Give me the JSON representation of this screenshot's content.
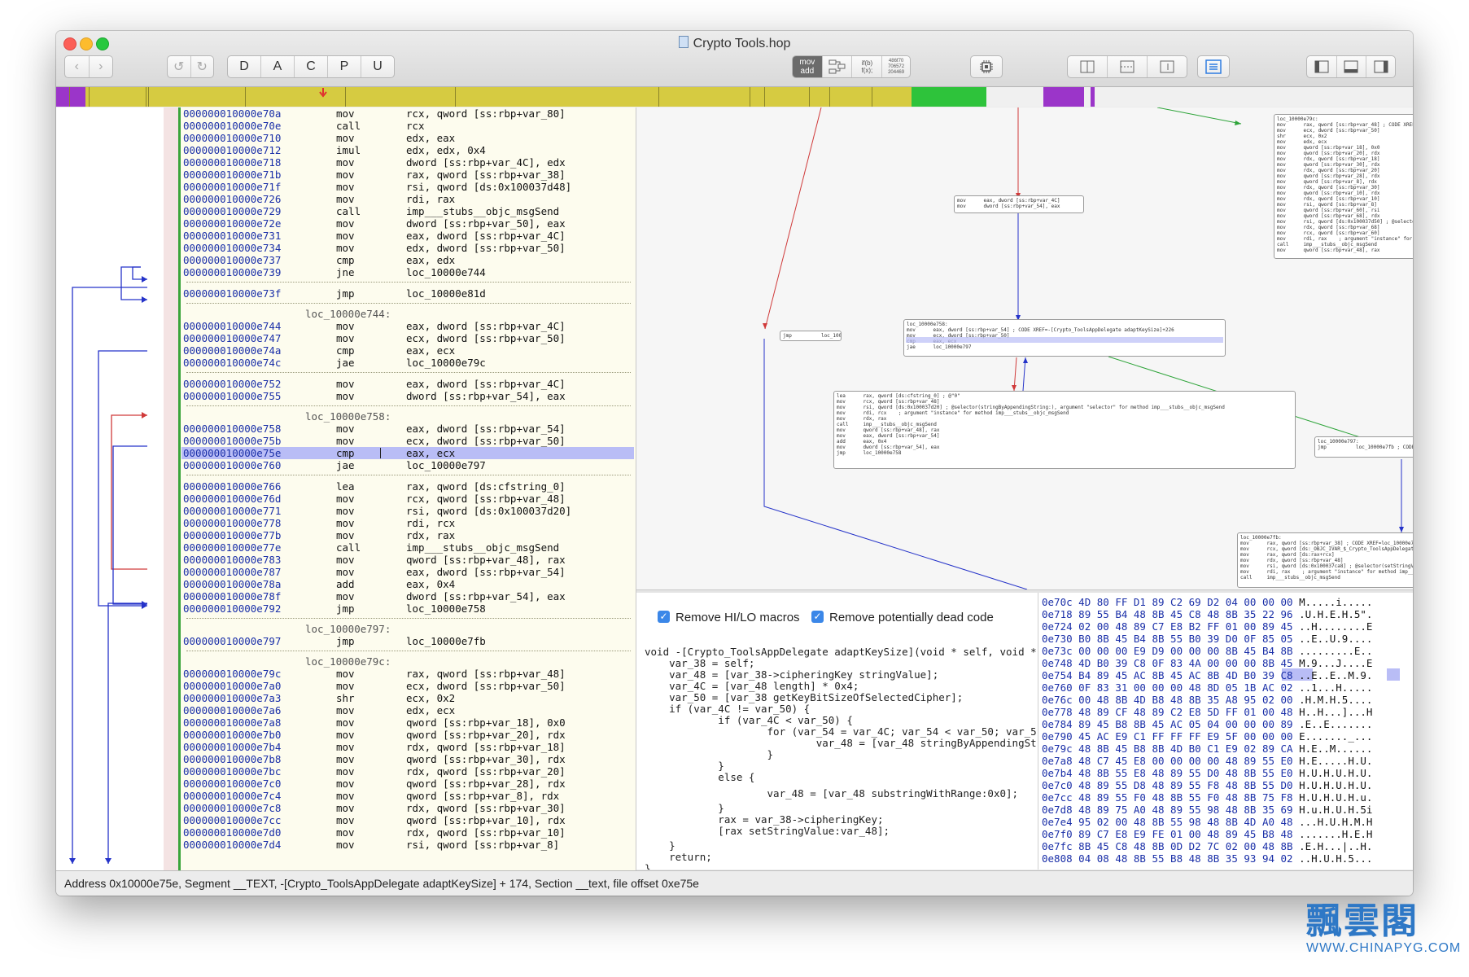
{
  "window": {
    "title": "Crypto Tools.hop",
    "toolbar": {
      "nav_back": "‹",
      "nav_forward": "›",
      "undo": "↺",
      "redo": "↻",
      "type_buttons": [
        "D",
        "A",
        "C",
        "P",
        "U"
      ],
      "mode_asm_line1": "mov",
      "mode_asm_line2": "add",
      "mode_pseudo_line1": "if(b)",
      "mode_pseudo_line2": "f(x);",
      "mode_hex_line1": "486f70",
      "mode_hex_line2": "706572",
      "mode_hex_line3": "204469"
    }
  },
  "asm": {
    "rows": [
      {
        "addr": "000000010000e70a",
        "mn": "mov",
        "op": "rcx, qword [ss:rbp+var_80]"
      },
      {
        "addr": "000000010000e70e",
        "mn": "call",
        "op": "rcx"
      },
      {
        "addr": "000000010000e710",
        "mn": "mov",
        "op": "edx, eax"
      },
      {
        "addr": "000000010000e712",
        "mn": "imul",
        "op": "edx, edx, 0x4"
      },
      {
        "addr": "000000010000e718",
        "mn": "mov",
        "op": "dword [ss:rbp+var_4C], edx"
      },
      {
        "addr": "000000010000e71b",
        "mn": "mov",
        "op": "rax, qword [ss:rbp+var_38]"
      },
      {
        "addr": "000000010000e71f",
        "mn": "mov",
        "op": "rsi, qword [ds:0x100037d48]"
      },
      {
        "addr": "000000010000e726",
        "mn": "mov",
        "op": "rdi, rax"
      },
      {
        "addr": "000000010000e729",
        "mn": "call",
        "op": "imp___stubs__objc_msgSend"
      },
      {
        "addr": "000000010000e72e",
        "mn": "mov",
        "op": "dword [ss:rbp+var_50], eax"
      },
      {
        "addr": "000000010000e731",
        "mn": "mov",
        "op": "eax, dword [ss:rbp+var_4C]"
      },
      {
        "addr": "000000010000e734",
        "mn": "mov",
        "op": "edx, dword [ss:rbp+var_50]"
      },
      {
        "addr": "000000010000e737",
        "mn": "cmp",
        "op": "eax, edx"
      },
      {
        "addr": "000000010000e739",
        "mn": "jne",
        "op": "loc_10000e744"
      },
      {
        "addr": "000000010000e73f",
        "mn": "jmp",
        "op": "loc_10000e81d"
      },
      {
        "addr": "000000010000e744",
        "mn": "mov",
        "op": "eax, dword [ss:rbp+var_4C]"
      },
      {
        "addr": "000000010000e747",
        "mn": "mov",
        "op": "ecx, dword [ss:rbp+var_50]"
      },
      {
        "addr": "000000010000e74a",
        "mn": "cmp",
        "op": "eax, ecx"
      },
      {
        "addr": "000000010000e74c",
        "mn": "jae",
        "op": "loc_10000e79c"
      },
      {
        "addr": "000000010000e752",
        "mn": "mov",
        "op": "eax, dword [ss:rbp+var_4C]"
      },
      {
        "addr": "000000010000e755",
        "mn": "mov",
        "op": "dword [ss:rbp+var_54], eax"
      },
      {
        "addr": "000000010000e758",
        "mn": "mov",
        "op": "eax, dword [ss:rbp+var_54]"
      },
      {
        "addr": "000000010000e75b",
        "mn": "mov",
        "op": "ecx, dword [ss:rbp+var_50]"
      },
      {
        "addr": "000000010000e75e",
        "mn": "cmp",
        "op": "eax, ecx"
      },
      {
        "addr": "000000010000e760",
        "mn": "jae",
        "op": "loc_10000e797"
      },
      {
        "addr": "000000010000e766",
        "mn": "lea",
        "op": "rax, qword [ds:cfstring_0]"
      },
      {
        "addr": "000000010000e76d",
        "mn": "mov",
        "op": "rcx, qword [ss:rbp+var_48]"
      },
      {
        "addr": "000000010000e771",
        "mn": "mov",
        "op": "rsi, qword [ds:0x100037d20]"
      },
      {
        "addr": "000000010000e778",
        "mn": "mov",
        "op": "rdi, rcx"
      },
      {
        "addr": "000000010000e77b",
        "mn": "mov",
        "op": "rdx, rax"
      },
      {
        "addr": "000000010000e77e",
        "mn": "call",
        "op": "imp___stubs__objc_msgSend"
      },
      {
        "addr": "000000010000e783",
        "mn": "mov",
        "op": "qword [ss:rbp+var_48], rax"
      },
      {
        "addr": "000000010000e787",
        "mn": "mov",
        "op": "eax, dword [ss:rbp+var_54]"
      },
      {
        "addr": "000000010000e78a",
        "mn": "add",
        "op": "eax, 0x4"
      },
      {
        "addr": "000000010000e78f",
        "mn": "mov",
        "op": "dword [ss:rbp+var_54], eax"
      },
      {
        "addr": "000000010000e792",
        "mn": "jmp",
        "op": "loc_10000e758"
      },
      {
        "addr": "000000010000e797",
        "mn": "jmp",
        "op": "loc_10000e7fb"
      },
      {
        "addr": "000000010000e79c",
        "mn": "mov",
        "op": "rax, qword [ss:rbp+var_48]"
      },
      {
        "addr": "000000010000e7a0",
        "mn": "mov",
        "op": "ecx, dword [ss:rbp+var_50]"
      },
      {
        "addr": "000000010000e7a3",
        "mn": "shr",
        "op": "ecx, 0x2"
      },
      {
        "addr": "000000010000e7a6",
        "mn": "mov",
        "op": "edx, ecx"
      },
      {
        "addr": "000000010000e7a8",
        "mn": "mov",
        "op": "qword [ss:rbp+var_18], 0x0"
      },
      {
        "addr": "000000010000e7b0",
        "mn": "mov",
        "op": "qword [ss:rbp+var_20], rdx"
      },
      {
        "addr": "000000010000e7b4",
        "mn": "mov",
        "op": "rdx, qword [ss:rbp+var_18]"
      },
      {
        "addr": "000000010000e7b8",
        "mn": "mov",
        "op": "qword [ss:rbp+var_30], rdx"
      },
      {
        "addr": "000000010000e7bc",
        "mn": "mov",
        "op": "rdx, qword [ss:rbp+var_20]"
      },
      {
        "addr": "000000010000e7c0",
        "mn": "mov",
        "op": "qword [ss:rbp+var_28], rdx"
      },
      {
        "addr": "000000010000e7c4",
        "mn": "mov",
        "op": "qword [ss:rbp+var_8], rdx"
      },
      {
        "addr": "000000010000e7c8",
        "mn": "mov",
        "op": "rdx, qword [ss:rbp+var_30]"
      },
      {
        "addr": "000000010000e7cc",
        "mn": "mov",
        "op": "qword [ss:rbp+var_10], rdx"
      },
      {
        "addr": "000000010000e7d0",
        "mn": "mov",
        "op": "rdx, qword [ss:rbp+var_10]"
      },
      {
        "addr": "000000010000e7d4",
        "mn": "mov",
        "op": "rsi, qword [ss:rbp+var_8]"
      }
    ],
    "labels": [
      "loc_10000e744:",
      "loc_10000e758:",
      "loc_10000e797:",
      "loc_10000e79c:"
    ]
  },
  "graph": {
    "block_top_right": "loc_10000e79c:\nmov      rax, qword [ss:rbp+var_48] ; CODE XREF=[Crypt\nmov      ecx, dword [ss:rbp+var_50]\nshr      ecx, 0x2\nmov      edx, ecx\nmov      qword [ss:rbp+var_18], 0x0\nmov      qword [ss:rbp+var_20], rdx\nmov      rdx, qword [ss:rbp+var_18]\nmov      qword [ss:rbp+var_30], rdx\nmov      rdx, qword [ss:rbp+var_20]\nmov      qword [ss:rbp+var_28], rdx\nmov      qword [ss:rbp+var_8], rdx\nmov      rdx, qword [ss:rbp+var_30]\nmov      qword [ss:rbp+var_10], rdx\nmov      rdx, qword [ss:rbp+var_10]\nmov      rsi, qword [ss:rbp+var_8]\nmov      qword [ss:rbp+var_60], rsi\nmov      qword [ss:rbp+var_68], rdx\nmov      rsi, qword [ds:0x100037d50] ; @selector(substr\nmov      rdx, qword [ss:rbp+var_68]\nmov      rcx, qword [ss:rbp+var_60]\nmov      rdi, rax    ; argument \"instance\" for method imp__\ncall     imp___stubs__objc_msgSend\nmov      qword [ss:rbp+var_48], rax",
    "block_small": "mov      eax, dword [ss:rbp+var_4C]\nmov      dword [ss:rbp+var_54], eax",
    "block_jmp": "jmp          loc_10000e81d",
    "block_e758": "loc_10000e758:\nmov      eax, dword [ss:rbp+var_54] ; CODE XREF=-[Crypto_ToolsAppDelegate adaptKeySize]+226\nmov      ecx, dword [ss:rbp+var_50]\ncmp      eax, ecx\njae      loc_10000e797",
    "block_loop": "lea      rax, qword [ds:cfstring_0] ; @\"0\"\nmov      rcx, qword [ss:rbp+var_48]\nmov      rsi, qword [ds:0x100037d20] ; @selector(stringByAppendingString:), argument \"selector\" for method imp___stubs__objc_msgSend\nmov      rdi, rcx    ; argument \"instance\" for method imp___stubs__objc_msgSend\nmov      rdx, rax\ncall     imp___stubs__objc_msgSend\nmov      qword [ss:rbp+var_48], rax\nmov      eax, dword [ss:rbp+var_54]\nadd      eax, 0x4\nmov      dword [ss:rbp+var_54], eax\njmp      loc_10000e758",
    "block_e797": "loc_10000e797:\njmp          loc_10000e7fb ; CODE XREF=-[Crypto",
    "block_e7fb": "loc_10000e7fb:\nmov      rax, qword [ss:rbp+var_38] ; CODE XREF=loc_10000e797\nmov      rcx, qword [ds:_OBJC_IVAR_$_Crypto_ToolsAppDelegate.ciphe\nmov      rax, qword [ds:rax+rcx]\nmov      rdx, qword [ss:rbp+var_48]\nmov      rsi, qword [ds:0x100037ca8] ; @selector(setStringValue:)\nmov      rdi, rax    ; argument \"instance\" for method imp___stub\ncall     imp___stubs__objc_msgSend"
  },
  "pseudo": {
    "option1": "Remove HI/LO macros",
    "option2": "Remove potentially dead code",
    "lines": [
      "void -[Crypto_ToolsAppDelegate adaptKeySize](void * self, void *",
      "    var_38 = self;",
      "    var_48 = [var_38->cipheringKey stringValue];",
      "    var_4C = [var_48 length] * 0x4;",
      "    var_50 = [var_38 getKeyBitSizeOfSelectedCipher];",
      "    if (var_4C != var_50) {",
      "            if (var_4C < var_50) {",
      "                    for (var_54 = var_4C; var_54 < var_50; var_5",
      "                            var_48 = [var_48 stringByAppendingSt",
      "                    }",
      "            }",
      "            else {",
      "                    var_48 = [var_48 substringWithRange:0x0];",
      "            }",
      "            rax = var_38->cipheringKey;",
      "            [rax setStringValue:var_48];",
      "    }",
      "    return;",
      "}"
    ]
  },
  "hex": {
    "rows": [
      {
        "a": "0e70c",
        "b": "4D 80 FF D1 89 C2 69 D2 04 00 00 00",
        "c": "M.....i....."
      },
      {
        "a": "0e718",
        "b": "89 55 B4 48 8B 45 C8 48 8B 35 22 96",
        "c": ".U.H.E.H.5\"."
      },
      {
        "a": "0e724",
        "b": "02 00 48 89 C7 E8 B2 FF 01 00 89 45",
        "c": "..H........E"
      },
      {
        "a": "0e730",
        "b": "B0 8B 45 B4 8B 55 B0 39 D0 0F 85 05",
        "c": "..E..U.9...."
      },
      {
        "a": "0e73c",
        "b": "00 00 00 E9 D9 00 00 00 8B 45 B4 8B",
        "c": ".........E.."
      },
      {
        "a": "0e748",
        "b": "4D B0 39 C8 0F 83 4A 00 00 00 8B 45",
        "c": "M.9...J....E"
      },
      {
        "a": "0e754",
        "b": "B4 89 45 AC 8B 45 AC 8B 4D B0 39 C8",
        "c": "..E..E..M.9."
      },
      {
        "a": "0e760",
        "b": "0F 83 31 00 00 00 48 8D 05 1B AC 02",
        "c": "..1...H....."
      },
      {
        "a": "0e76c",
        "b": "00 48 8B 4D B8 48 8B 35 A8 95 02 00",
        "c": ".H.M.H.5...."
      },
      {
        "a": "0e778",
        "b": "48 89 CF 48 89 C2 E8 5D FF 01 00 48",
        "c": "H..H...]...H"
      },
      {
        "a": "0e784",
        "b": "89 45 B8 8B 45 AC 05 04 00 00 00 89",
        "c": ".E..E......."
      },
      {
        "a": "0e790",
        "b": "45 AC E9 C1 FF FF FF E9 5F 00 00 00",
        "c": "E......._..."
      },
      {
        "a": "0e79c",
        "b": "48 8B 45 B8 8B 4D B0 C1 E9 02 89 CA",
        "c": "H.E..M......"
      },
      {
        "a": "0e7a8",
        "b": "48 C7 45 E8 00 00 00 00 48 89 55 E0",
        "c": "H.E.....H.U."
      },
      {
        "a": "0e7b4",
        "b": "48 8B 55 E8 48 89 55 D0 48 8B 55 E0",
        "c": "H.U.H.U.H.U."
      },
      {
        "a": "0e7c0",
        "b": "48 89 55 D8 48 89 55 F8 48 8B 55 D0",
        "c": "H.U.H.U.H.U."
      },
      {
        "a": "0e7cc",
        "b": "48 89 55 F0 48 8B 55 F0 48 8B 75 F8",
        "c": "H.U.H.U.H.u."
      },
      {
        "a": "0e7d8",
        "b": "48 89 75 A0 48 89 55 98 48 8B 35 69",
        "c": "H.u.H.U.H.5i"
      },
      {
        "a": "0e7e4",
        "b": "95 02 00 48 8B 55 98 48 8B 4D A0 48",
        "c": "...H.U.H.M.H"
      },
      {
        "a": "0e7f0",
        "b": "89 C7 E8 E9 FE 01 00 48 89 45 B8 48",
        "c": ".......H.E.H"
      },
      {
        "a": "0e7fc",
        "b": "8B 45 C8 48 8B 0D D2 7C 02 00 48 8B",
        "c": ".E.H...|..H."
      },
      {
        "a": "0e808",
        "b": "04 08 48 8B 55 B8 48 8B 35 93 94 02",
        "c": "..H.U.H.5..."
      }
    ]
  },
  "status": {
    "text": "Address 0x10000e75e, Segment __TEXT, -[Crypto_ToolsAppDelegate adaptKeySize] + 174, Section __text, file offset 0xe75e"
  },
  "watermark": {
    "chinese": "飄雲閣",
    "url": "WWW.CHINAPYG.COM"
  },
  "colors": {
    "navbar_code": "#d6cb41",
    "navbar_purple": "#9b35c9",
    "navbar_green": "#2ec33b",
    "address_blue": "#1a2fa8",
    "selection": "#b9bdf6",
    "arrow_blue": "#2533c9",
    "arrow_red": "#d03a3a"
  }
}
